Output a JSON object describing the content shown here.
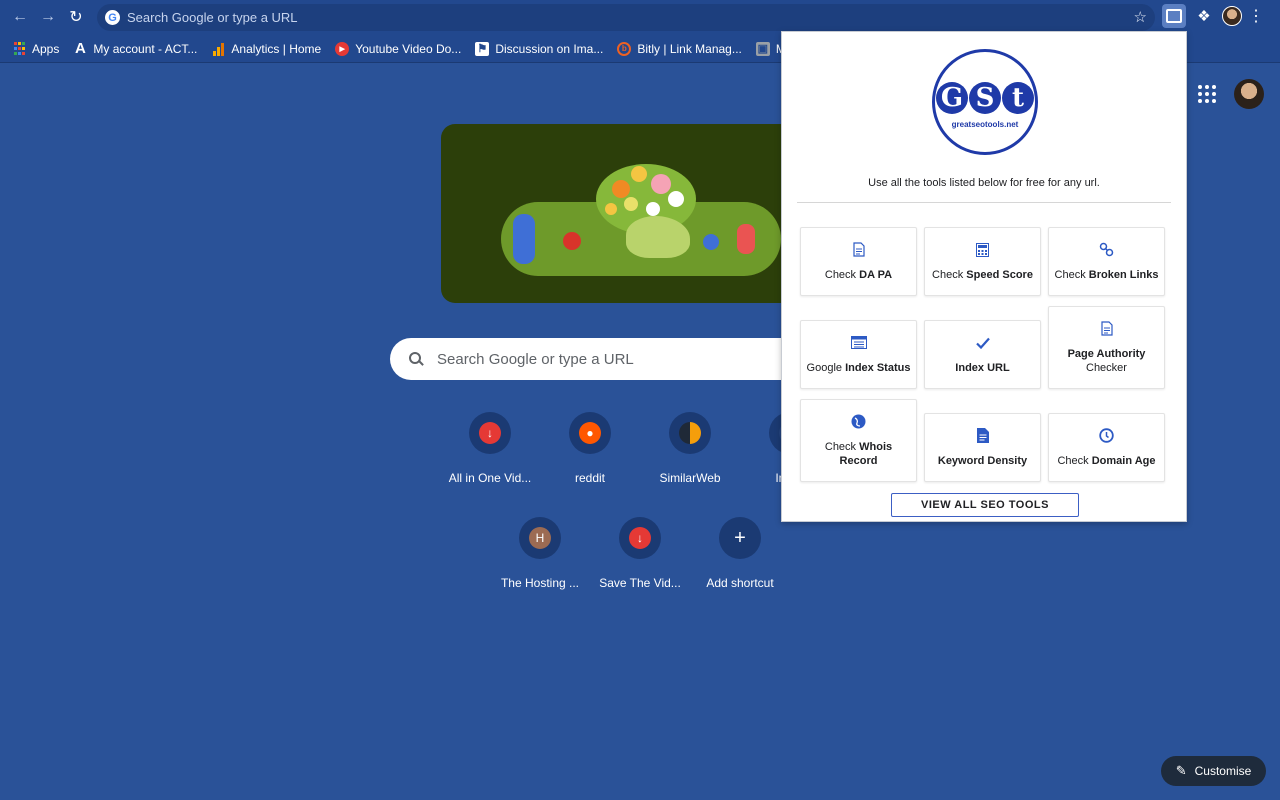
{
  "browser": {
    "omnibox_placeholder": "Search Google or type a URL"
  },
  "bookmarks": [
    {
      "label": "Apps",
      "icon": "apps-grid-icon"
    },
    {
      "label": "My account - ACT...",
      "icon": "act-logo-icon"
    },
    {
      "label": "Analytics | Home",
      "icon": "analytics-icon"
    },
    {
      "label": "Youtube Video Do...",
      "icon": "youtube-icon"
    },
    {
      "label": "Discussion on Ima...",
      "icon": "discussion-icon"
    },
    {
      "label": "Bitly | Link Manag...",
      "icon": "bitly-icon"
    },
    {
      "label": "Mo",
      "icon": "bookmark-icon"
    }
  ],
  "ntp": {
    "search_placeholder": "Search Google or type a URL",
    "shortcuts": [
      {
        "label": "All in One Vid...",
        "initial": "",
        "color": "#e53935"
      },
      {
        "label": "reddit",
        "initial": "",
        "color": "#ff5700"
      },
      {
        "label": "SimilarWeb",
        "initial": "",
        "color": "#1f2937"
      },
      {
        "label": "Inbox",
        "initial": "",
        "color": "#1b3a73"
      },
      {
        "label": "The Hosting ...",
        "initial": "H",
        "color": "#9c6b53"
      },
      {
        "label": "Save The Vid...",
        "initial": "",
        "color": "#e53935"
      },
      {
        "label": "Add shortcut",
        "initial": "+",
        "color": "#1b3a73"
      }
    ],
    "customise_label": "Customise"
  },
  "popup": {
    "logo_letters": [
      "G",
      "S",
      "t"
    ],
    "logo_domain": "greatseotools.net",
    "description": "Use all the tools listed below for free for any url.",
    "tools": [
      {
        "pre": "Check ",
        "bold": "DA PA",
        "post": "",
        "icon": "document-icon"
      },
      {
        "pre": "Check ",
        "bold": "Speed Score",
        "post": "",
        "icon": "calculator-icon"
      },
      {
        "pre": "Check ",
        "bold": "Broken Links",
        "post": "",
        "icon": "link-icon"
      },
      {
        "pre": "Google ",
        "bold": "Index Status",
        "post": "",
        "icon": "list-window-icon"
      },
      {
        "pre": "",
        "bold": "Index URL",
        "post": "",
        "icon": "checkmark-icon"
      },
      {
        "pre": "",
        "bold": "Page Authority",
        "post": "Checker",
        "icon": "document-icon"
      },
      {
        "pre": "Check ",
        "bold": "Whois",
        "post": "Record",
        "icon": "globe-icon"
      },
      {
        "pre": "",
        "bold": "Keyword Density",
        "post": "",
        "icon": "text-document-icon"
      },
      {
        "pre": "Check ",
        "bold": "Domain Age",
        "post": "",
        "icon": "clock-icon"
      }
    ],
    "view_all_label": "VIEW ALL SEO TOOLS"
  }
}
